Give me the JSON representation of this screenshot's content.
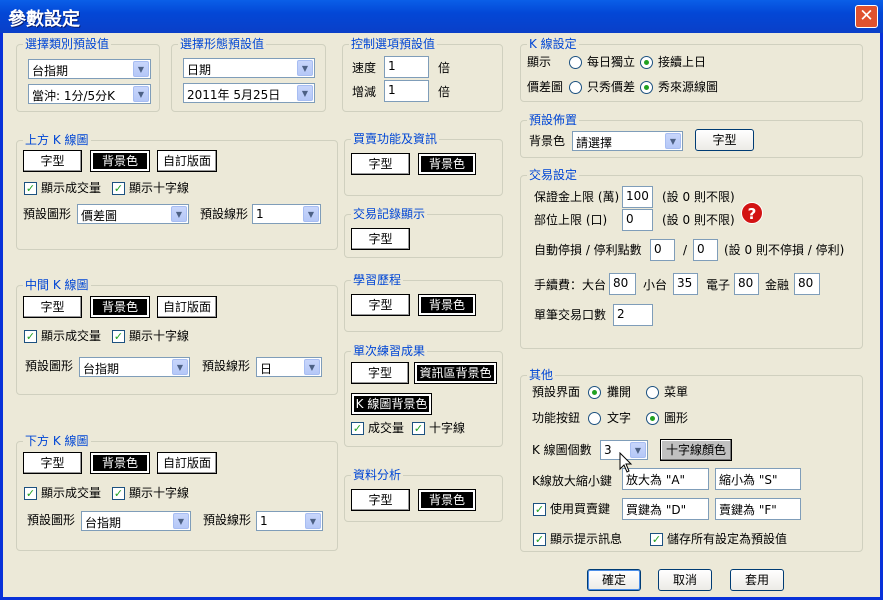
{
  "window": {
    "title": "參數設定",
    "close": "✕"
  },
  "g_type": {
    "title": "選擇類別預設值",
    "combo1": "台指期",
    "combo2": "當沖: 1分/5分K"
  },
  "g_form": {
    "title": "選擇形態預設值",
    "combo1": "日期",
    "combo2": "2011年  5月25日"
  },
  "g_ctrl": {
    "title": "控制選項預設值",
    "speed_label": "速度",
    "speed": "1",
    "speed_unit": "倍",
    "inc_label": "增減",
    "inc": "1",
    "inc_unit": "倍"
  },
  "g_kline": {
    "title": "K 線設定",
    "show_label": "顯示",
    "opt1": "每日獨立",
    "opt2": "接續上日",
    "diff_label": "價差圖",
    "opt3": "只秀價差",
    "opt4": "秀來源線圖"
  },
  "g_upper": {
    "title": "上方 K 線圖",
    "font": "字型",
    "bg": "背景色",
    "layout": "自訂版面",
    "vol": "顯示成交量",
    "cross": "顯示十字線",
    "shape_label": "預設圖形",
    "shape": "價差圖",
    "line_label": "預設線形",
    "line": "1"
  },
  "g_middle": {
    "title": "中間 K 線圖",
    "font": "字型",
    "bg": "背景色",
    "layout": "自訂版面",
    "vol": "顯示成交量",
    "cross": "顯示十字線",
    "shape_label": "預設圖形",
    "shape": "台指期",
    "line_label": "預設線形",
    "line": "日"
  },
  "g_lower": {
    "title": "下方 K 線圖",
    "font": "字型",
    "bg": "背景色",
    "layout": "自訂版面",
    "vol": "顯示成交量",
    "cross": "顯示十字線",
    "shape_label": "預設圖形",
    "shape": "台指期",
    "line_label": "預設線形",
    "line": "1"
  },
  "g_trade_fn": {
    "title": "買賣功能及資訊",
    "font": "字型",
    "bg": "背景色"
  },
  "g_trade_rec": {
    "title": "交易記錄顯示",
    "font": "字型"
  },
  "g_learn": {
    "title": "學習歷程",
    "font": "字型",
    "bg": "背景色"
  },
  "g_single": {
    "title": "單次練習成果",
    "font": "字型",
    "info_bg": "資訊區背景色",
    "k_bg": "K 線圖背景色",
    "vol": "成交量",
    "cross": "十字線"
  },
  "g_analysis": {
    "title": "資料分析",
    "font": "字型",
    "bg": "背景色"
  },
  "g_layout": {
    "title": "預設佈置",
    "bg_label": "背景色",
    "bg": "請選擇",
    "font": "字型"
  },
  "g_trade_set": {
    "title": "交易設定",
    "margin_label": "保證金上限 (萬)",
    "margin": "100",
    "margin_hint": "(設 0 則不限)",
    "pos_label": "部位上限 (口)",
    "pos": "0",
    "pos_hint": "(設 0 則不限)",
    "stop_label": "自動停損 / 停利點數",
    "stop": "0",
    "slash": "/",
    "profit": "0",
    "stop_hint": "(設 0 則不停損 / 停利)",
    "fee_label": "手續費：大台",
    "fee_big": "80",
    "fee_small_label": "小台",
    "fee_small": "35",
    "fee_elec_label": "電子",
    "fee_elec": "80",
    "fee_fin_label": "金融",
    "fee_fin": "80",
    "qty_label": "單筆交易口數",
    "qty": "2",
    "help": "?"
  },
  "g_other": {
    "title": "其他",
    "ui_label": "預設界面",
    "ui1": "攤開",
    "ui2": "菜單",
    "btn_label": "功能按鈕",
    "btn1": "文字",
    "btn2": "圖形",
    "kcount_label": "K 線圖個數",
    "kcount": "3",
    "cross_color": "十字線顏色",
    "zoom_label": "K線放大縮小鍵",
    "zoom_in": "放大為 \"A\"",
    "zoom_out": "縮小為 \"S\"",
    "trade_key": "使用買賣鍵",
    "buy": "買鍵為 \"D\"",
    "sell": "賣鍵為 \"F\"",
    "tips": "顯示提示訊息",
    "save": "儲存所有設定為預設值"
  },
  "footer": {
    "ok": "確定",
    "cancel": "取消",
    "apply": "套用"
  },
  "colors": {
    "title_bar": "#0a5fe8",
    "group_title": "#0046d5",
    "dialog_bg": "#ece9d8"
  }
}
